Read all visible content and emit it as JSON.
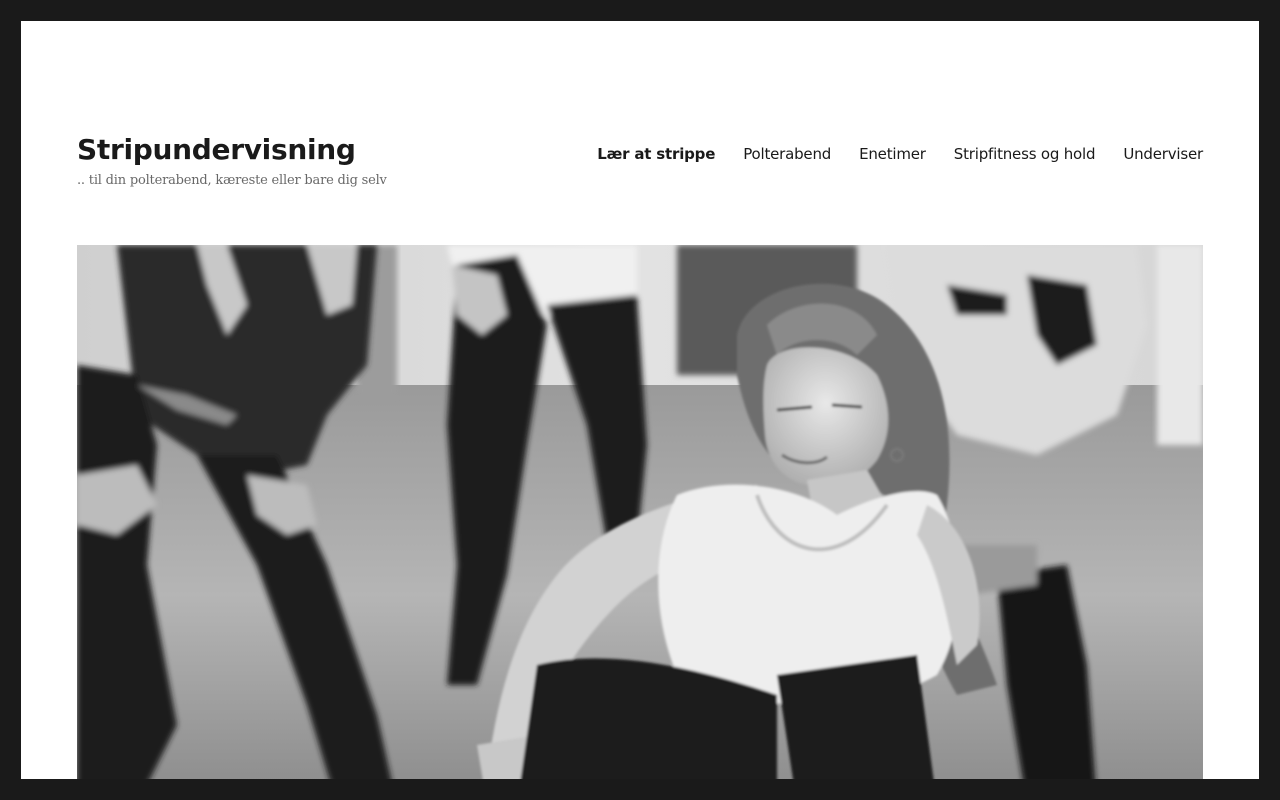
{
  "site": {
    "title": "Stripundervisning",
    "description": ".. til din polterabend, kæreste eller bare dig selv"
  },
  "nav": {
    "items": [
      {
        "label": "Lær at strippe",
        "current": true
      },
      {
        "label": "Polterabend",
        "current": false
      },
      {
        "label": "Enetimer",
        "current": false
      },
      {
        "label": "Stripfitness og hold",
        "current": false
      },
      {
        "label": "Underviser",
        "current": false
      }
    ]
  },
  "header_image": {
    "subject": "black-and-white photo of women in a dance class",
    "tone": "grayscale"
  },
  "colors": {
    "outer_frame": "#1a1a1a",
    "page_background": "#ffffff",
    "text_primary": "#1a1a1a",
    "text_secondary": "#686868"
  }
}
